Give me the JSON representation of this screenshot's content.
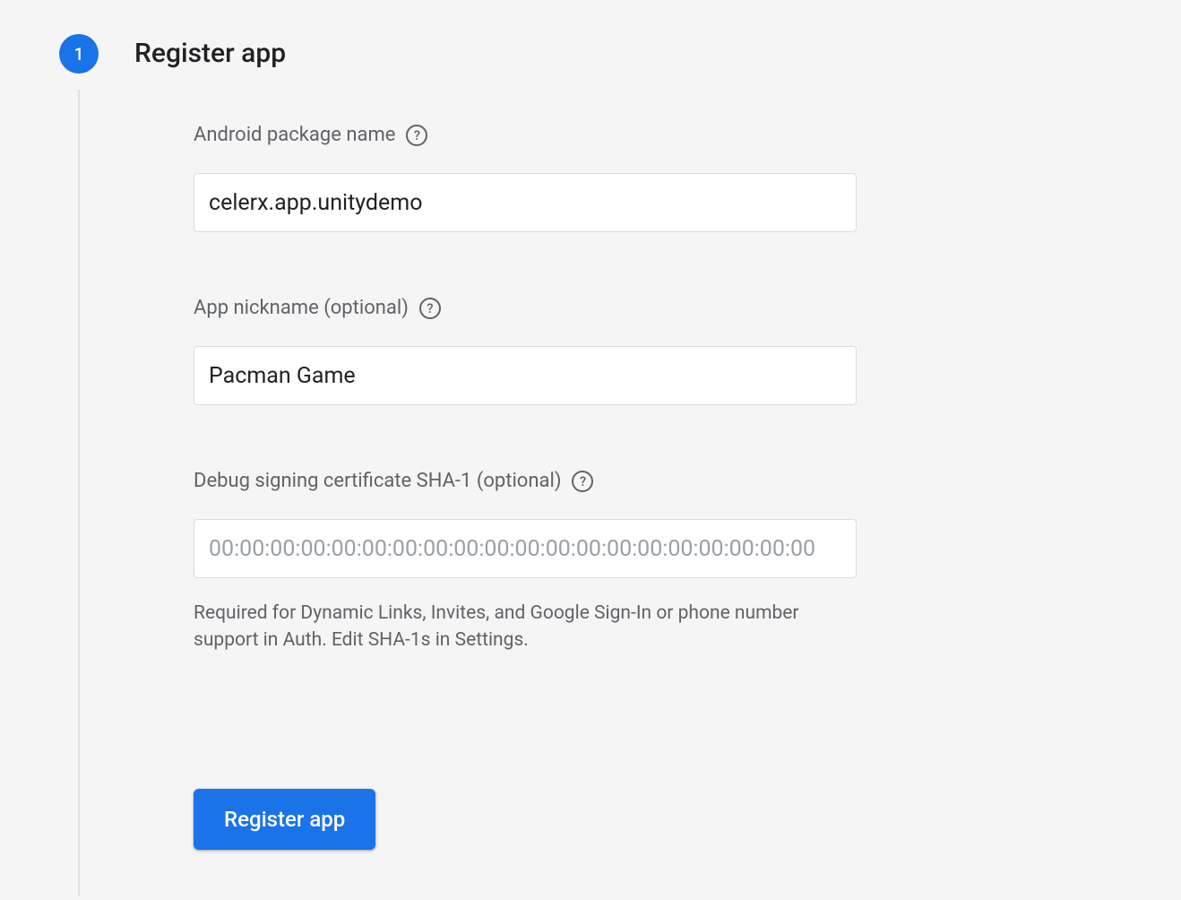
{
  "step": {
    "number": "1",
    "title": "Register app"
  },
  "fields": {
    "package_name": {
      "label": "Android package name",
      "value": "celerx.app.unitydemo"
    },
    "nickname": {
      "label": "App nickname (optional)",
      "value": "Pacman Game"
    },
    "sha1": {
      "label": "Debug signing certificate SHA-1 (optional)",
      "value": "",
      "placeholder": "00:00:00:00:00:00:00:00:00:00:00:00:00:00:00:00:00:00:00:00",
      "helper": "Required for Dynamic Links, Invites, and Google Sign-In or phone number support in Auth. Edit SHA-1s in Settings."
    }
  },
  "submit": {
    "label": "Register app"
  }
}
